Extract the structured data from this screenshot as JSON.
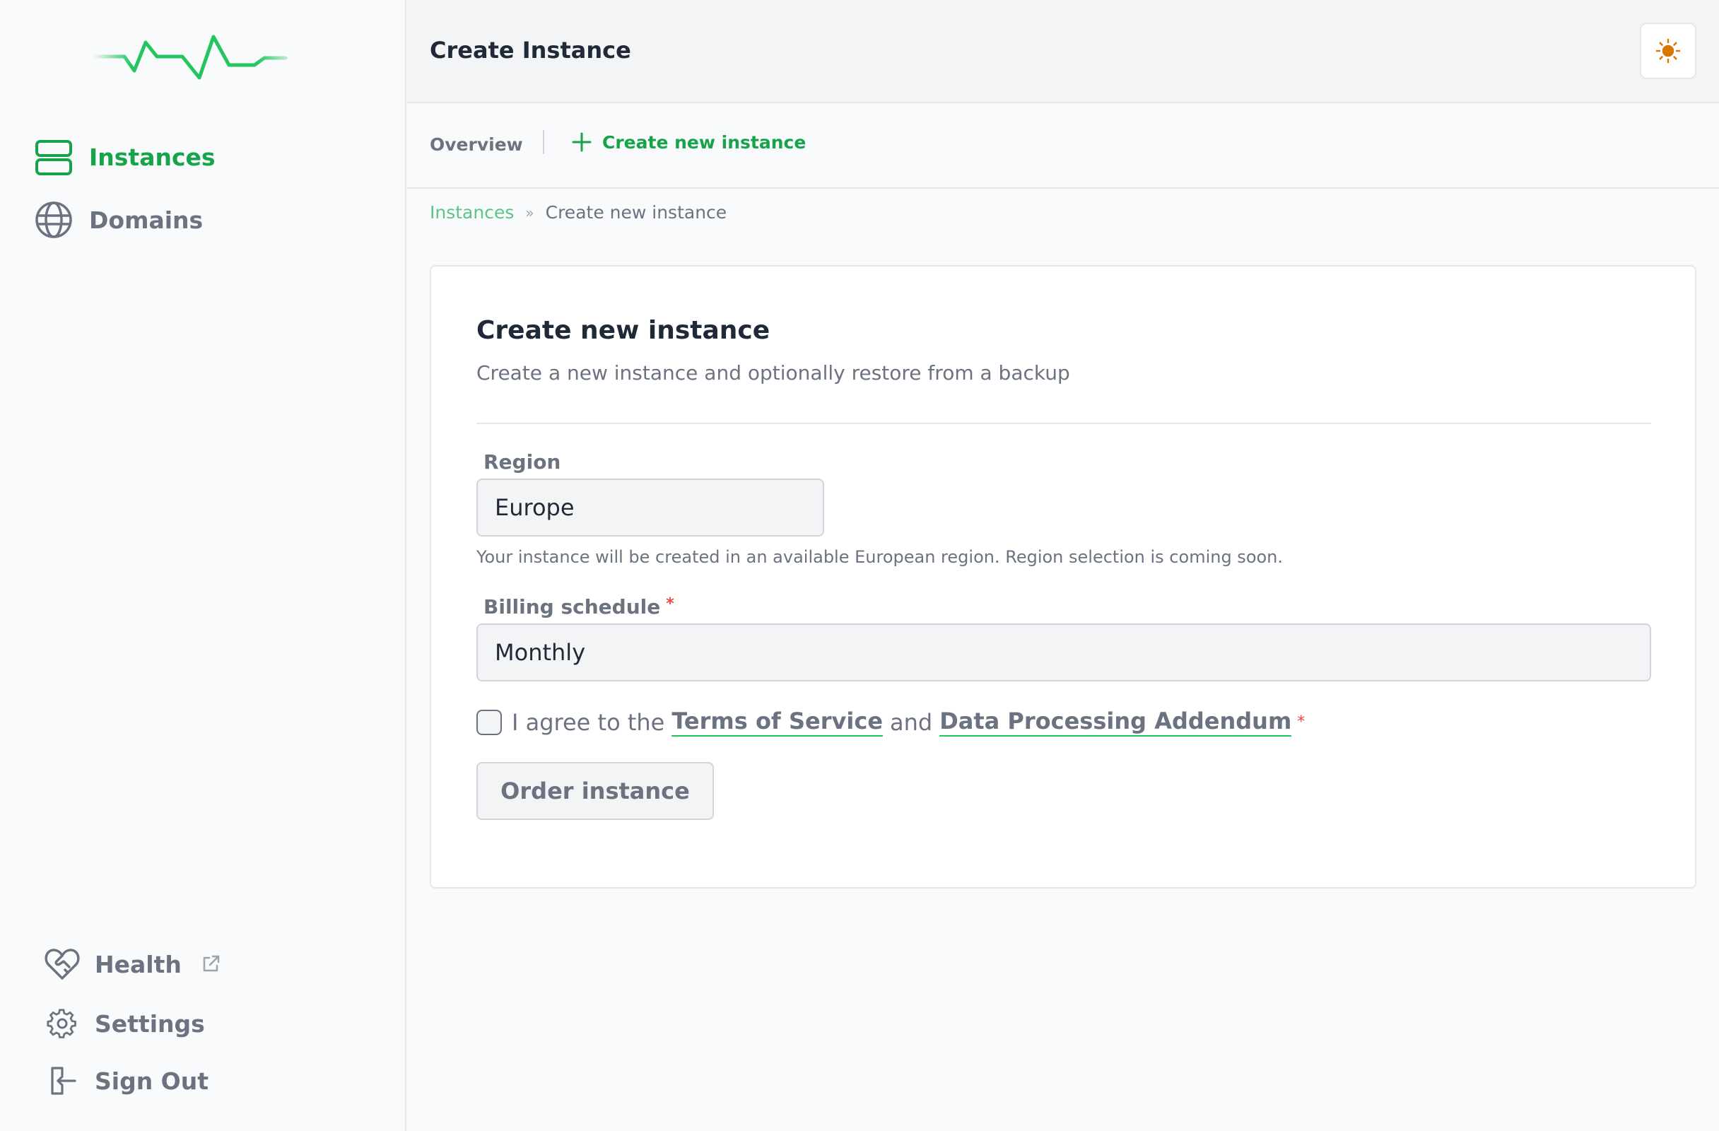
{
  "colors": {
    "accent": "#16a34a",
    "muted_text": "#6b7280",
    "required": "#ef4444",
    "sun": "#d97706"
  },
  "sidebar": {
    "logo_icon": "heartbeat-pulse-logo",
    "nav": [
      {
        "label": "Instances",
        "icon": "server-stack-icon",
        "active": true
      },
      {
        "label": "Domains",
        "icon": "globe-icon",
        "active": false
      }
    ],
    "bottom": [
      {
        "label": "Health",
        "icon": "heart-handshake-icon",
        "external": true
      },
      {
        "label": "Settings",
        "icon": "gear-icon"
      },
      {
        "label": "Sign Out",
        "icon": "sign-out-icon"
      }
    ]
  },
  "header": {
    "title": "Create Instance",
    "theme_icon": "sun-icon"
  },
  "subnav": {
    "overview": "Overview",
    "create": "Create new instance"
  },
  "breadcrumb": {
    "root": "Instances",
    "separator": "»",
    "current": "Create new instance"
  },
  "form": {
    "title": "Create new instance",
    "subtitle": "Create a new instance and optionally restore from a backup",
    "region": {
      "label": "Region",
      "value": "Europe",
      "hint": "Your instance will be created in an available European region. Region selection is coming soon."
    },
    "billing": {
      "label": "Billing schedule",
      "required_mark": "*",
      "value": "Monthly"
    },
    "agree": {
      "prefix": "I agree to the",
      "tos": "Terms of Service",
      "and": "and",
      "dpa": "Data Processing Addendum",
      "required_mark": "*",
      "checked": false
    },
    "submit": "Order instance"
  }
}
